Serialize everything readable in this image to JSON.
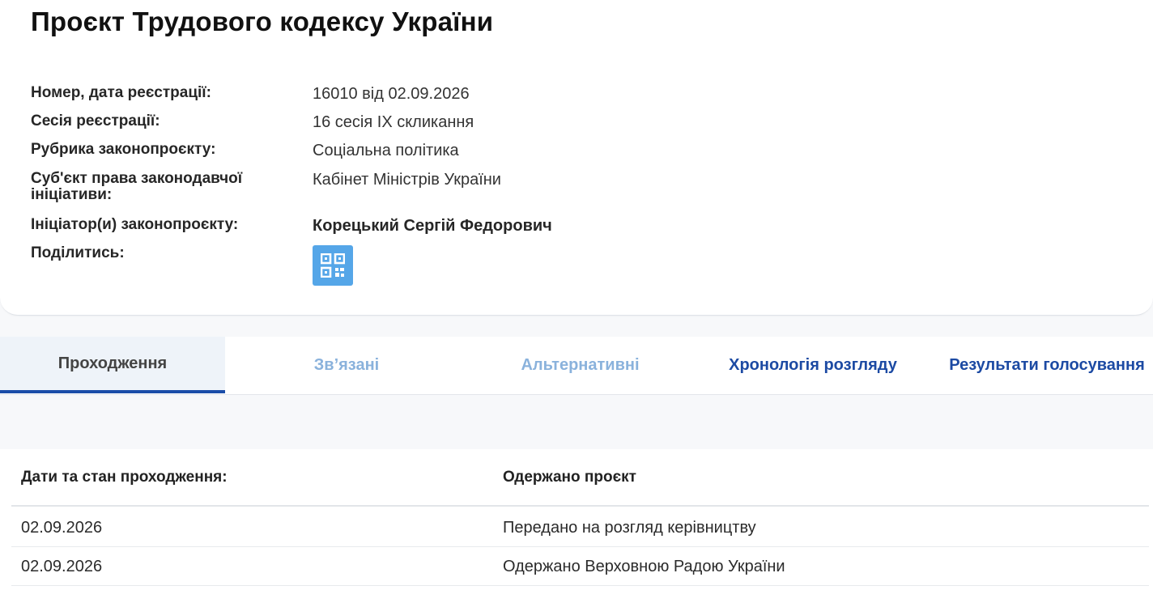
{
  "page": {
    "title": "Проєкт Трудового кодексу України"
  },
  "info": {
    "rows": [
      {
        "label": "Номер, дата реєстрації:",
        "value": "16010 від 02.09.2026"
      },
      {
        "label": "Сесія реєстрації:",
        "value": "16 сесія IX скликання"
      },
      {
        "label": "Рубрика законопроєкту:",
        "value": "Соціальна політика"
      },
      {
        "label": "Суб'єкт права законодавчої ініціативи:",
        "value": "Кабінет Міністрів України"
      },
      {
        "label": "Ініціатор(и) законопроєкту:",
        "value": "Корецький Сергій Федорович"
      },
      {
        "label": "Поділитись:",
        "value": ""
      }
    ],
    "share_icon": "qr-code-icon",
    "share_color": "#55a6e8"
  },
  "tabs": [
    {
      "label": "Проходження",
      "state": "active"
    },
    {
      "label": "Зв’язані",
      "state": "disabled"
    },
    {
      "label": "Альтернативні",
      "state": "disabled"
    },
    {
      "label": "Хронологія розгляду",
      "state": "link"
    },
    {
      "label": "Результати голосування",
      "state": "link"
    }
  ],
  "passage": {
    "header": [
      "Дати та стан проходження:",
      "Одержано проєкт"
    ],
    "rows": [
      [
        "02.09.2026",
        "Передано на розгляд керівництву"
      ],
      [
        "02.09.2026",
        "Одержано Верховною Радою України"
      ]
    ]
  },
  "colors": {
    "accent": "#1b4da8",
    "link": "#1c4aa3",
    "muted_tab": "#8ab2dc"
  }
}
